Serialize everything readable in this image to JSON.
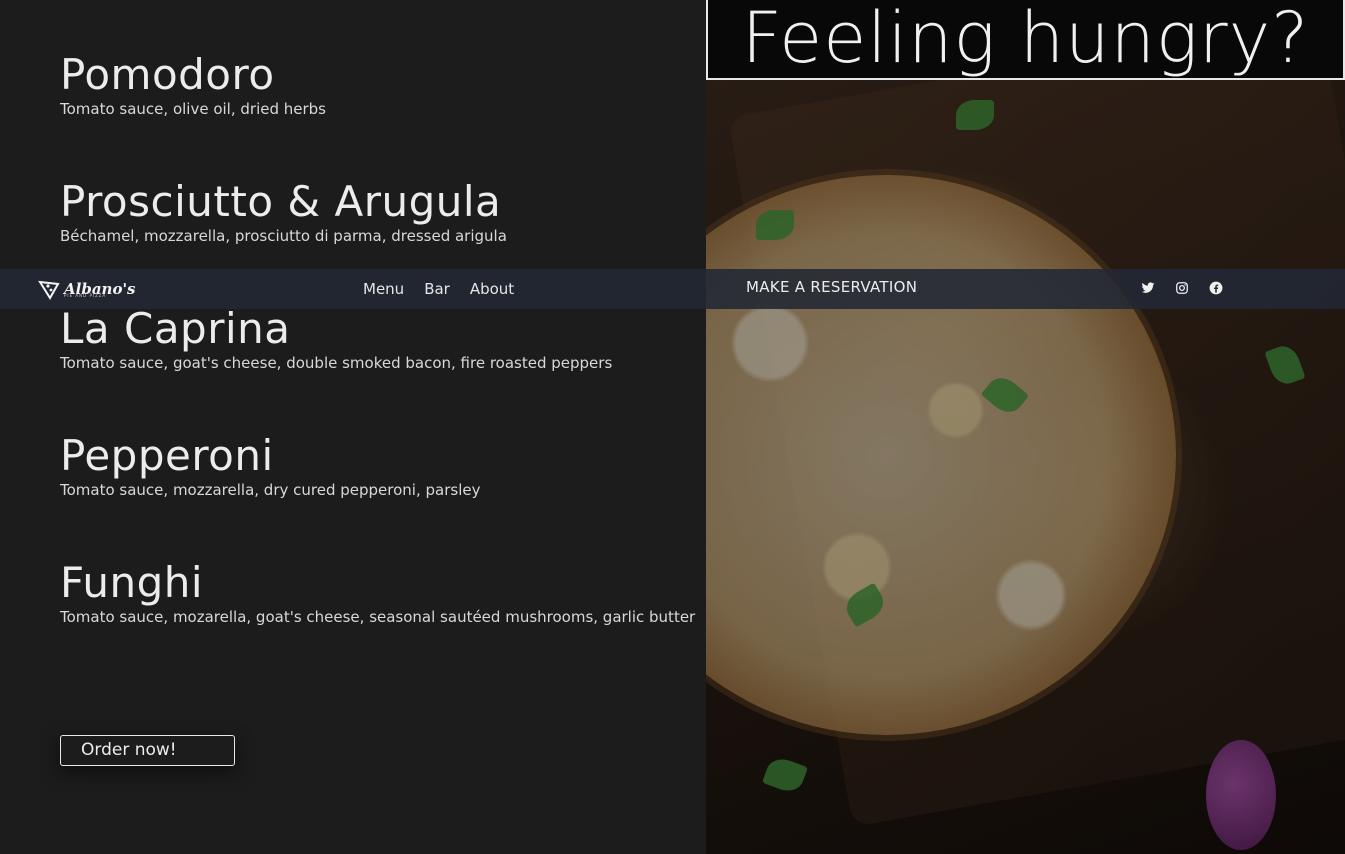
{
  "hero": {
    "title": "Feeling hungry?"
  },
  "nav": {
    "logo_text": "Albano's",
    "logo_subtext": "PIE AND PIZZA",
    "links": [
      {
        "label": "Menu"
      },
      {
        "label": "Bar"
      },
      {
        "label": "About"
      }
    ],
    "reservation_label": "MAKE A RESERVATION",
    "socials": [
      {
        "icon": "twitter-icon"
      },
      {
        "icon": "instagram-icon"
      },
      {
        "icon": "facebook-icon"
      }
    ]
  },
  "menu": {
    "items": [
      {
        "name": "Pomodoro",
        "description": "Tomato sauce, olive oil, dried herbs"
      },
      {
        "name": "Prosciutto & Arugula",
        "description": "Béchamel, mozzarella, prosciutto di parma, dressed arigula"
      },
      {
        "name": "La Caprina",
        "description": "Tomato sauce, goat's cheese, double smoked bacon, fire roasted peppers"
      },
      {
        "name": "Pepperoni",
        "description": "Tomato sauce, mozzarella, dry cured pepperoni, parsley"
      },
      {
        "name": "Funghi",
        "description": "Tomato sauce, mozarella, goat's cheese, seasonal sautéed mushrooms, garlic butter"
      }
    ],
    "order_button": "Order now!"
  },
  "colors": {
    "background": "#1c1c1c",
    "navbar": "#222834",
    "text": "#ececec"
  }
}
